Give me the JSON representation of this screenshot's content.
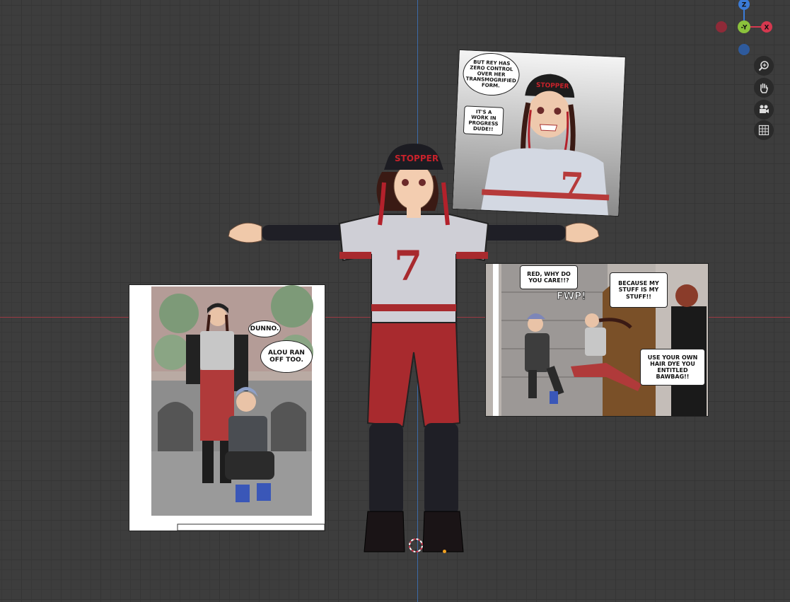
{
  "viewport": {
    "background": "#3d3d3d",
    "x_axis_color": "#9b3a44",
    "z_axis_color": "#3c6aa8"
  },
  "navigation_gizmo": {
    "axes": [
      {
        "label": "Z",
        "color": "#3b7bd6"
      },
      {
        "label": "-Y",
        "color": "#8bc23c"
      },
      {
        "label": "X",
        "color": "#d5384f"
      }
    ]
  },
  "viewport_tools": [
    {
      "name": "zoom-icon"
    },
    {
      "name": "hand-pan-icon"
    },
    {
      "name": "camera-icon"
    },
    {
      "name": "grid-icon"
    }
  ],
  "character": {
    "cap_text": "STOPPER",
    "jersey_number": "7"
  },
  "panel_top_right": {
    "bubble1": "BUT REY HAS ZERO CONTROL OVER HER TRANSMOGRIFIED FORM.",
    "bubble2": "IT'S A WORK IN PROGRESS DUDE!!",
    "cap_text": "STOPPER",
    "jersey_number": "7"
  },
  "panel_left": {
    "bubble1": "DUNNO.",
    "bubble2": "ALOU RAN OFF TOO."
  },
  "panel_right": {
    "bubble1": "RED, WHY DO YOU CARE!!?",
    "bubble2": "BECAUSE MY STUFF IS MY STUFF!!",
    "sfx": "FWP!",
    "bubble3": "USE YOUR OWN HAIR DYE YOU ENTITLED BAWBAG!!"
  }
}
